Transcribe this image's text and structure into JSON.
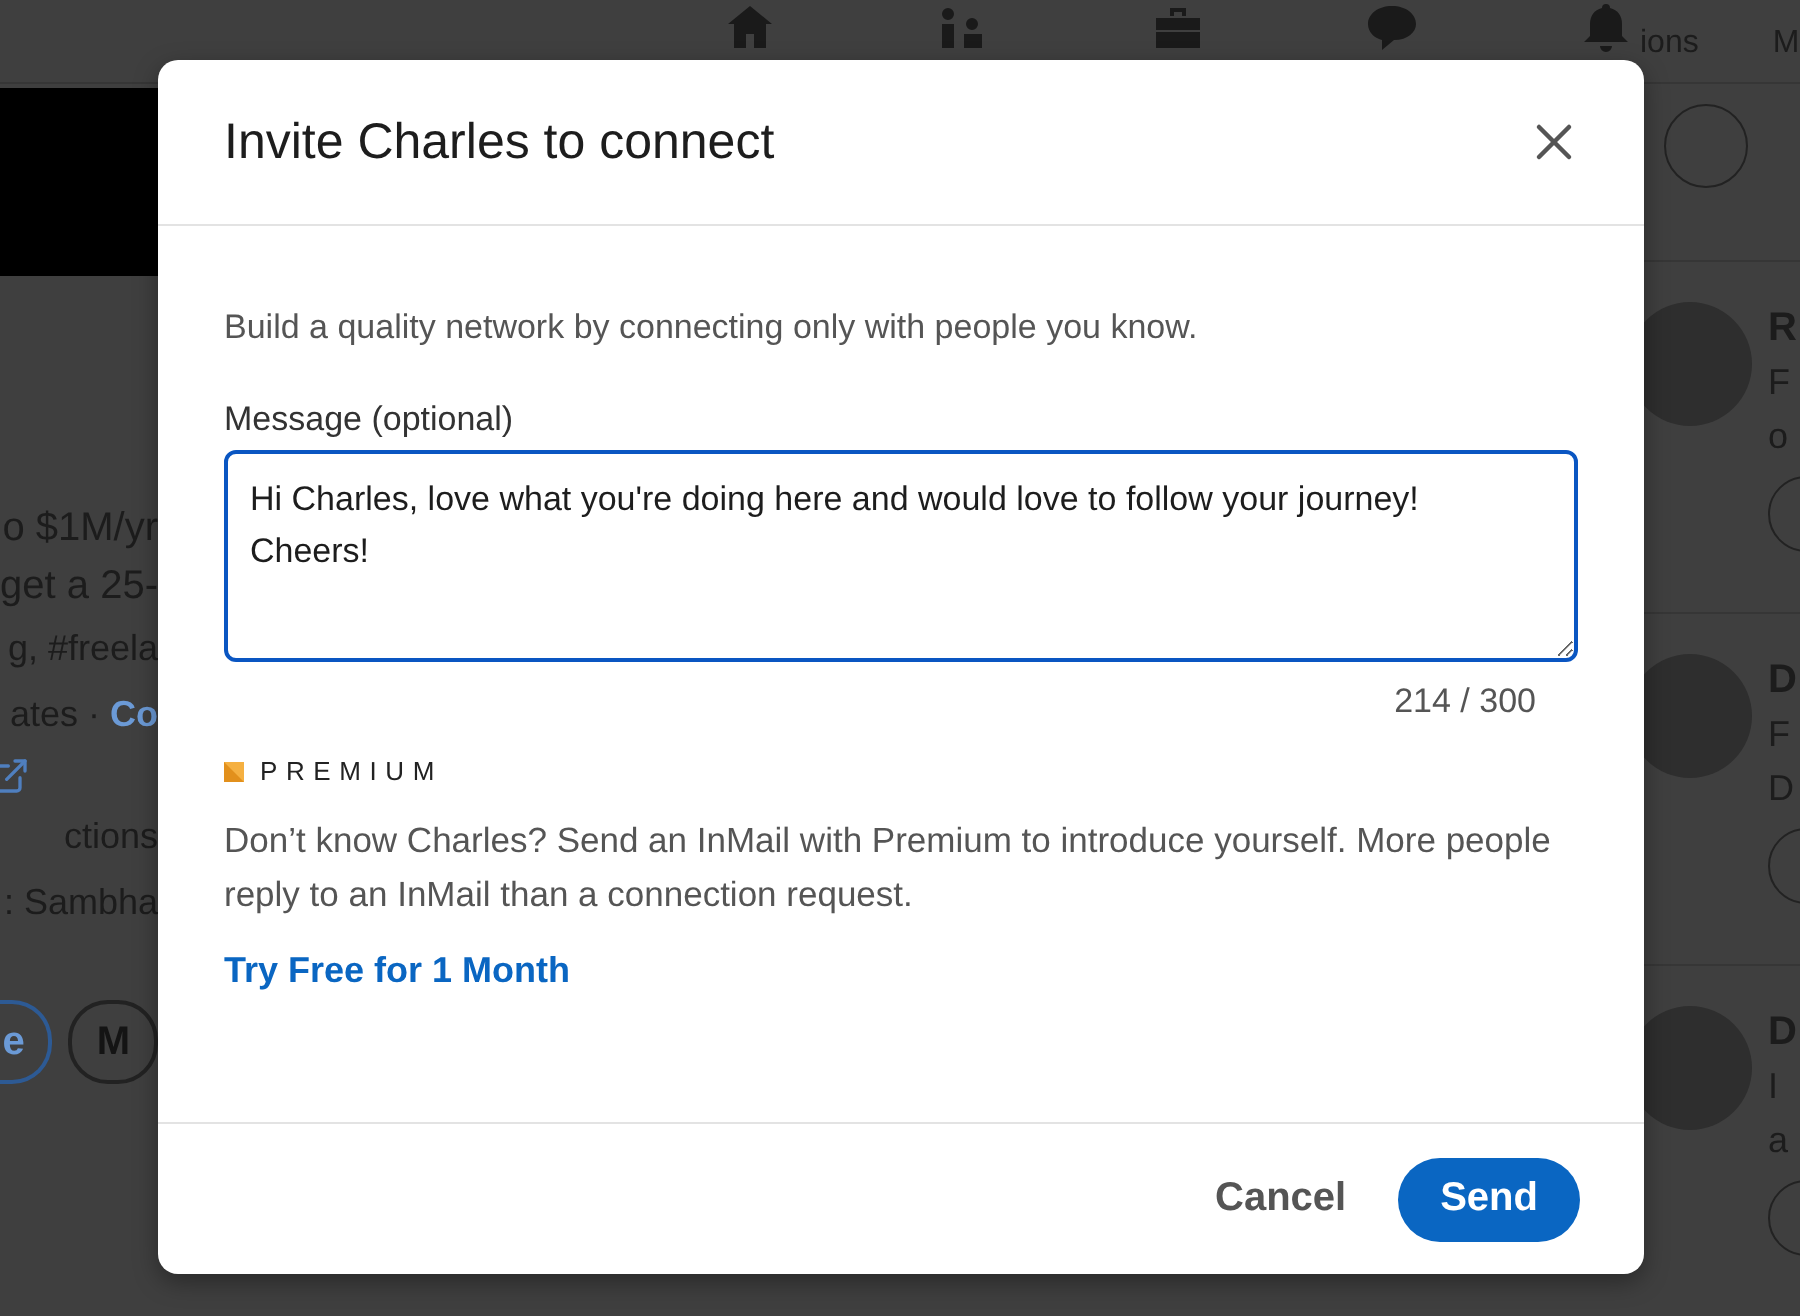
{
  "background": {
    "nav_labels": [
      "ions",
      "M"
    ],
    "left_texts": [
      {
        "text": "o $1M/yr",
        "kind": "title"
      },
      {
        "text": "get a 25-",
        "kind": "title"
      },
      {
        "text": "g, #freela",
        "kind": "meta"
      },
      {
        "text": "ates · ",
        "link": "Co",
        "kind": "meta"
      },
      {
        "kind": "external"
      },
      {
        "text": "ctions",
        "kind": "meta"
      },
      {
        "text": ": Sambha",
        "kind": "meta"
      }
    ],
    "left_buttons": [
      {
        "label": "e",
        "kind": "primary"
      },
      {
        "label": "M",
        "kind": "secondary"
      }
    ],
    "people": [
      {
        "name": "R",
        "line_1": "F",
        "line_2": "o"
      },
      {
        "name": "D",
        "line_1": "F",
        "line_2": "D"
      },
      {
        "name": "D",
        "line_1": "I",
        "line_2": "a"
      }
    ]
  },
  "dialog": {
    "title": "Invite Charles to connect",
    "intro": "Build a quality network by connecting only with people you know.",
    "message": {
      "label": "Message (optional)",
      "value": "Hi Charles, love what you're doing here and would love to follow your journey! Cheers!",
      "counter": "214 / 300",
      "focused": true
    },
    "premium": {
      "badge": "PREMIUM",
      "text": "Don’t know Charles? Send an InMail with Premium to introduce yourself. More people reply to an InMail than a connection request.",
      "link": "Try Free for 1 Month"
    },
    "buttons": [
      {
        "label": "Cancel",
        "kind": "secondary"
      },
      {
        "label": "Send",
        "kind": "primary"
      }
    ]
  }
}
